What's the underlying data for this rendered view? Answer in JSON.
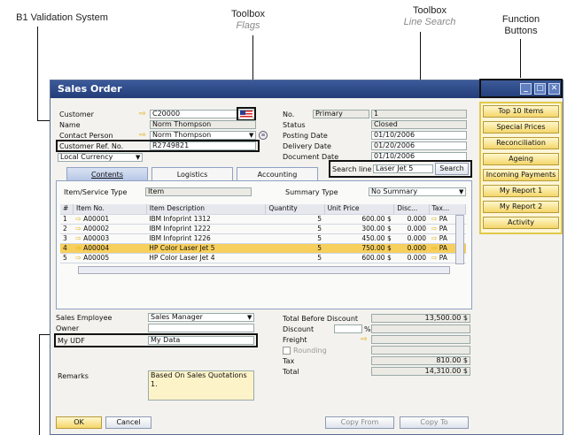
{
  "annotations": {
    "b1_validation": "B1 Validation System",
    "toolbox_flags_title": "Toolbox",
    "toolbox_flags_sub": "Flags",
    "toolbox_search_title": "Toolbox",
    "toolbox_search_sub": "Line Search",
    "function_buttons_line1": "Function",
    "function_buttons_line2": "Buttons"
  },
  "window": {
    "title": "Sales Order",
    "min": "_",
    "max": "□",
    "close": "✕"
  },
  "header": {
    "customer_label": "Customer",
    "customer_value": "C20000",
    "name_label": "Name",
    "name_value": "Norm Thompson",
    "contact_label": "Contact Person",
    "contact_value": "Norm Thompson",
    "custref_label": "Customer Ref. No.",
    "custref_value": "R2749821",
    "currency_value": "Local Currency",
    "no_label": "No.",
    "no_series": "Primary",
    "no_value": "1",
    "status_label": "Status",
    "status_value": "Closed",
    "posting_label": "Posting Date",
    "posting_value": "01/10/2006",
    "delivery_label": "Delivery Date",
    "delivery_value": "01/20/2006",
    "document_label": "Document Date",
    "document_value": "01/10/2006"
  },
  "tabs": [
    "Contents",
    "Logistics",
    "Accounting"
  ],
  "search": {
    "label": "Search line",
    "value": "Laser Jet 5",
    "button": "Search"
  },
  "contents": {
    "type_label": "Item/Service Type",
    "type_value": "Item",
    "summary_label": "Summary Type",
    "summary_value": "No Summary"
  },
  "grid": {
    "columns": [
      "#",
      "Item No.",
      "Item Description",
      "Quantity",
      "Unit Price",
      "Disc...",
      "Tax..."
    ],
    "rows": [
      {
        "n": "1",
        "item": "A00001",
        "desc": "IBM Infoprint 1312",
        "qty": "5",
        "price": "600.00 $",
        "disc": "0.000",
        "tax": "PA"
      },
      {
        "n": "2",
        "item": "A00002",
        "desc": "IBM Infoprint 1222",
        "qty": "5",
        "price": "300.00 $",
        "disc": "0.000",
        "tax": "PA"
      },
      {
        "n": "3",
        "item": "A00003",
        "desc": "IBM Infoprint 1226",
        "qty": "5",
        "price": "450.00 $",
        "disc": "0.000",
        "tax": "PA"
      },
      {
        "n": "4",
        "item": "A00004",
        "desc": "HP Color Laser Jet 5",
        "qty": "5",
        "price": "750.00 $",
        "disc": "0.000",
        "tax": "PA"
      },
      {
        "n": "5",
        "item": "A00005",
        "desc": "HP Color Laser Jet 4",
        "qty": "5",
        "price": "600.00 $",
        "disc": "0.000",
        "tax": "PA"
      }
    ],
    "highlighted_row": 3
  },
  "footer": {
    "employee_label": "Sales Employee",
    "employee_value": "Sales Manager",
    "owner_label": "Owner",
    "udf_label": "My UDF",
    "udf_value": "My Data",
    "remarks_label": "Remarks",
    "remarks_value": "Based On Sales Quotations 1.",
    "tbd_label": "Total Before Discount",
    "tbd_value": "13,500.00 $",
    "discount_label": "Discount",
    "discount_pct": "%",
    "freight_label": "Freight",
    "rounding_label": "Rounding",
    "tax_label": "Tax",
    "tax_value": "810.00 $",
    "total_label": "Total",
    "total_value": "14,310.00 $"
  },
  "buttons": {
    "ok": "OK",
    "cancel": "Cancel",
    "copy_from": "Copy From",
    "copy_to": "Copy To"
  },
  "function_buttons": [
    "Top 10 Items",
    "Special Prices",
    "Reconciliation",
    "Ageing",
    "Incoming Payments",
    "My Report 1",
    "My Report 2",
    "Activity"
  ],
  "colors": {
    "title_bar": "#2c4a8a",
    "highlight_row": "#f6cf5c",
    "function_button": "#f4d66a"
  }
}
